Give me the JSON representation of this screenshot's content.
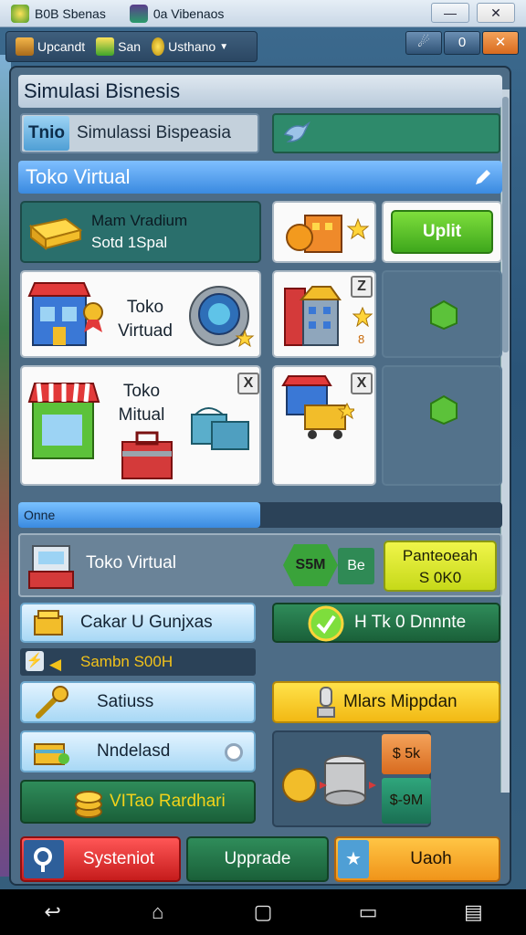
{
  "os_bar": {
    "tab1_label": "B0B Sbenas",
    "tab2_label": "0a Vibenaos",
    "min_label": "—",
    "close_label": "✕"
  },
  "toolbar": {
    "item1_label": "Upcandt",
    "item2_label": "San",
    "item3_label": "Usthano",
    "ctl1_label": "☄",
    "ctl2_label": "0",
    "ctl3_label": "✕"
  },
  "panel": {
    "title": "Simulasi Bisnesis",
    "search": {
      "tag": "Tnio",
      "text": "Simulassi Bispeasia"
    },
    "section_header": "Toko Virtual",
    "featured": {
      "line1": "Mam Vradium",
      "line2": "Sotd 1Spal"
    },
    "upgrade_label": "Uplit",
    "store1_label": [
      "Toko",
      "Virtuad"
    ],
    "store2_label": [
      "Toko",
      "Mitual"
    ],
    "badge_store_top": "Z",
    "badge_store2": "X",
    "badge_store_bottom": "X",
    "small_badge": "8",
    "progress_label": "Onne",
    "progress_fraction": 0.5,
    "bank_label": "Toko Virtual",
    "hex_cash": "S5M",
    "cash_tab": "Be",
    "yellow_cta": [
      "Panteoeah",
      "S 0K0"
    ],
    "btn_list": [
      {
        "label": "Cakar U Gunjxas"
      },
      {
        "label": "H Tk 0 Dnnnte"
      },
      {
        "label": "Sambn S00H"
      },
      {
        "label": "Satiuss"
      },
      {
        "label": "Mlars Mippdan"
      },
      {
        "label": "Nndelasd"
      },
      {
        "label": "VITao Rardhari"
      }
    ],
    "price1": "$ 5k",
    "price2": "$-9M",
    "bottom_buttons": [
      {
        "label": "Systeniot"
      },
      {
        "label": "Upprade"
      },
      {
        "label": "Uaoh"
      }
    ]
  },
  "nav": {
    "back": "↩",
    "home": "⌂",
    "recent": "▢",
    "menu1": "▭",
    "menu2": "▤"
  }
}
